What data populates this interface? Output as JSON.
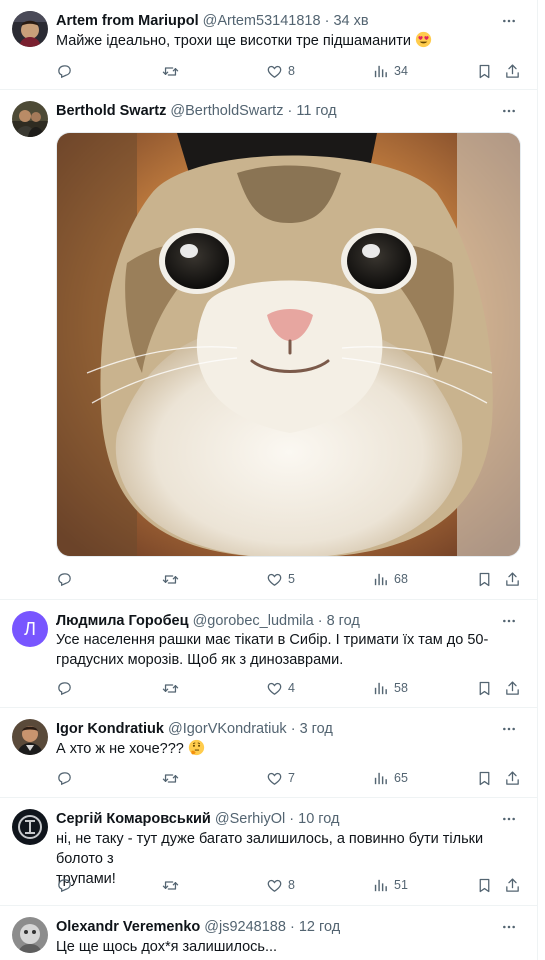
{
  "tweets": [
    {
      "name": "Artem from Mariupol",
      "handle": "@Artem53141818",
      "dot": "·",
      "time": "34 хв",
      "text": "Майже ідеально, трохи ще висотки тре підшаманити",
      "emoji": "heart-eyes-emoji",
      "likes": "8",
      "views": "34"
    },
    {
      "name": "Berthold Swartz",
      "handle": "@BertholdSwartz",
      "dot": "·",
      "time": "11 год",
      "image": "smiling-cat-photo",
      "likes": "5",
      "views": "68"
    },
    {
      "name": "Людмила Горобец",
      "handle": "@gorobec_ludmila",
      "dot": "·",
      "time": "8 год",
      "avatar_letter": "Л",
      "text_line1": "Усе населення рашки має тікати в Сибір. І тримати їх там до 50-",
      "text_line2": "градусних морозів. Щоб як з динозаврами.",
      "likes": "4",
      "views": "58"
    },
    {
      "name": "Igor Kondratiuk",
      "handle": "@IgorVKondratiuk",
      "dot": "·",
      "time": "3 год",
      "text": "А хто ж не хоче???",
      "emoji": "thinking-face-emoji",
      "likes": "7",
      "views": "65"
    },
    {
      "name": "Сергій Комаровський",
      "handle": "@SerhiyOl",
      "dot": "·",
      "time": "10 год",
      "text_line1": "ні, не таку - тут дуже багато залишилось, а повинно бути тільки болото з",
      "text_line2": "трупами!",
      "likes": "8",
      "views": "51"
    },
    {
      "name": "Olexandr Veremenko",
      "handle": "@js9248188",
      "dot": "·",
      "time": "12 год",
      "text": "Це ще щось дох*я залишилось..."
    }
  ],
  "colors": {
    "text": "#0f1419",
    "secondary": "#536471",
    "divider": "#eff3f4",
    "avatar_purple": "#7856ff"
  }
}
